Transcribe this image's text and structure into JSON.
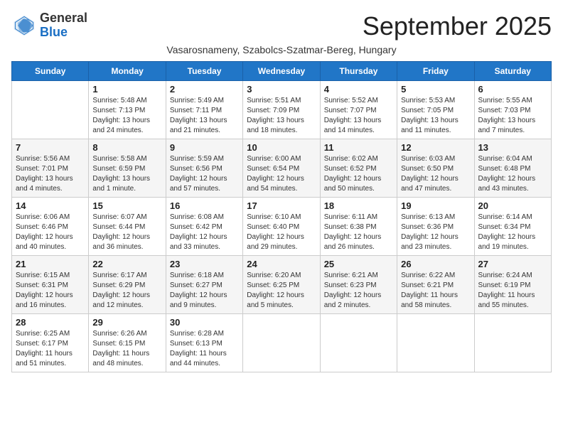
{
  "header": {
    "logo_general": "General",
    "logo_blue": "Blue",
    "month_title": "September 2025",
    "subtitle": "Vasarosnameny, Szabolcs-Szatmar-Bereg, Hungary"
  },
  "days_of_week": [
    "Sunday",
    "Monday",
    "Tuesday",
    "Wednesday",
    "Thursday",
    "Friday",
    "Saturday"
  ],
  "weeks": [
    [
      {
        "day": "",
        "info": ""
      },
      {
        "day": "1",
        "info": "Sunrise: 5:48 AM\nSunset: 7:13 PM\nDaylight: 13 hours\nand 24 minutes."
      },
      {
        "day": "2",
        "info": "Sunrise: 5:49 AM\nSunset: 7:11 PM\nDaylight: 13 hours\nand 21 minutes."
      },
      {
        "day": "3",
        "info": "Sunrise: 5:51 AM\nSunset: 7:09 PM\nDaylight: 13 hours\nand 18 minutes."
      },
      {
        "day": "4",
        "info": "Sunrise: 5:52 AM\nSunset: 7:07 PM\nDaylight: 13 hours\nand 14 minutes."
      },
      {
        "day": "5",
        "info": "Sunrise: 5:53 AM\nSunset: 7:05 PM\nDaylight: 13 hours\nand 11 minutes."
      },
      {
        "day": "6",
        "info": "Sunrise: 5:55 AM\nSunset: 7:03 PM\nDaylight: 13 hours\nand 7 minutes."
      }
    ],
    [
      {
        "day": "7",
        "info": "Sunrise: 5:56 AM\nSunset: 7:01 PM\nDaylight: 13 hours\nand 4 minutes."
      },
      {
        "day": "8",
        "info": "Sunrise: 5:58 AM\nSunset: 6:59 PM\nDaylight: 13 hours\nand 1 minute."
      },
      {
        "day": "9",
        "info": "Sunrise: 5:59 AM\nSunset: 6:56 PM\nDaylight: 12 hours\nand 57 minutes."
      },
      {
        "day": "10",
        "info": "Sunrise: 6:00 AM\nSunset: 6:54 PM\nDaylight: 12 hours\nand 54 minutes."
      },
      {
        "day": "11",
        "info": "Sunrise: 6:02 AM\nSunset: 6:52 PM\nDaylight: 12 hours\nand 50 minutes."
      },
      {
        "day": "12",
        "info": "Sunrise: 6:03 AM\nSunset: 6:50 PM\nDaylight: 12 hours\nand 47 minutes."
      },
      {
        "day": "13",
        "info": "Sunrise: 6:04 AM\nSunset: 6:48 PM\nDaylight: 12 hours\nand 43 minutes."
      }
    ],
    [
      {
        "day": "14",
        "info": "Sunrise: 6:06 AM\nSunset: 6:46 PM\nDaylight: 12 hours\nand 40 minutes."
      },
      {
        "day": "15",
        "info": "Sunrise: 6:07 AM\nSunset: 6:44 PM\nDaylight: 12 hours\nand 36 minutes."
      },
      {
        "day": "16",
        "info": "Sunrise: 6:08 AM\nSunset: 6:42 PM\nDaylight: 12 hours\nand 33 minutes."
      },
      {
        "day": "17",
        "info": "Sunrise: 6:10 AM\nSunset: 6:40 PM\nDaylight: 12 hours\nand 29 minutes."
      },
      {
        "day": "18",
        "info": "Sunrise: 6:11 AM\nSunset: 6:38 PM\nDaylight: 12 hours\nand 26 minutes."
      },
      {
        "day": "19",
        "info": "Sunrise: 6:13 AM\nSunset: 6:36 PM\nDaylight: 12 hours\nand 23 minutes."
      },
      {
        "day": "20",
        "info": "Sunrise: 6:14 AM\nSunset: 6:34 PM\nDaylight: 12 hours\nand 19 minutes."
      }
    ],
    [
      {
        "day": "21",
        "info": "Sunrise: 6:15 AM\nSunset: 6:31 PM\nDaylight: 12 hours\nand 16 minutes."
      },
      {
        "day": "22",
        "info": "Sunrise: 6:17 AM\nSunset: 6:29 PM\nDaylight: 12 hours\nand 12 minutes."
      },
      {
        "day": "23",
        "info": "Sunrise: 6:18 AM\nSunset: 6:27 PM\nDaylight: 12 hours\nand 9 minutes."
      },
      {
        "day": "24",
        "info": "Sunrise: 6:20 AM\nSunset: 6:25 PM\nDaylight: 12 hours\nand 5 minutes."
      },
      {
        "day": "25",
        "info": "Sunrise: 6:21 AM\nSunset: 6:23 PM\nDaylight: 12 hours\nand 2 minutes."
      },
      {
        "day": "26",
        "info": "Sunrise: 6:22 AM\nSunset: 6:21 PM\nDaylight: 11 hours\nand 58 minutes."
      },
      {
        "day": "27",
        "info": "Sunrise: 6:24 AM\nSunset: 6:19 PM\nDaylight: 11 hours\nand 55 minutes."
      }
    ],
    [
      {
        "day": "28",
        "info": "Sunrise: 6:25 AM\nSunset: 6:17 PM\nDaylight: 11 hours\nand 51 minutes."
      },
      {
        "day": "29",
        "info": "Sunrise: 6:26 AM\nSunset: 6:15 PM\nDaylight: 11 hours\nand 48 minutes."
      },
      {
        "day": "30",
        "info": "Sunrise: 6:28 AM\nSunset: 6:13 PM\nDaylight: 11 hours\nand 44 minutes."
      },
      {
        "day": "",
        "info": ""
      },
      {
        "day": "",
        "info": ""
      },
      {
        "day": "",
        "info": ""
      },
      {
        "day": "",
        "info": ""
      }
    ]
  ]
}
